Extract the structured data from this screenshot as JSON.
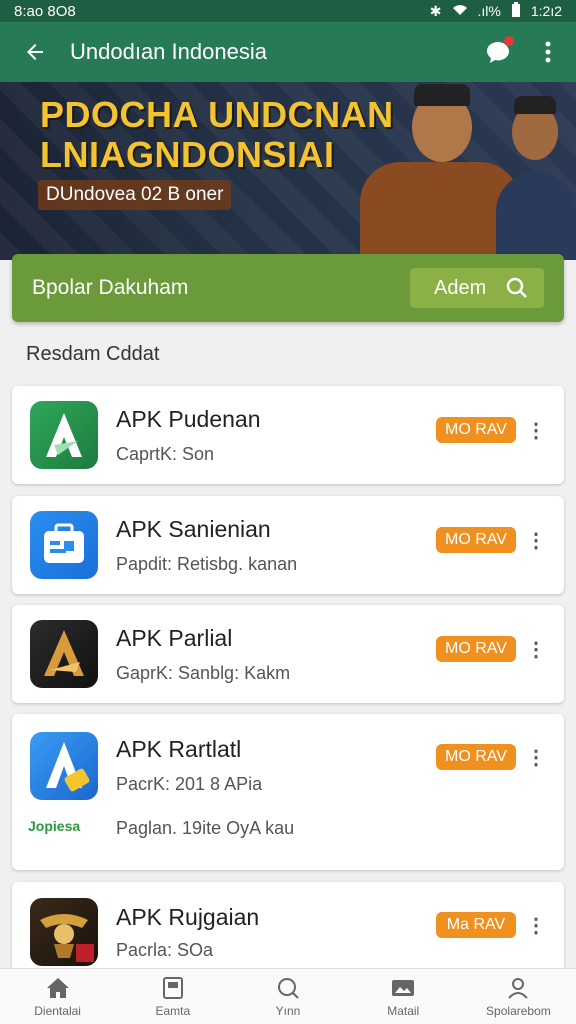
{
  "status_bar": {
    "time": "8:ao 8O8",
    "right_time": "1:2ı2",
    "signal": ".ıl%"
  },
  "app_bar": {
    "title": "Undodıan Indonesia"
  },
  "banner": {
    "title_line1": "PDOCHA UNDCNAN",
    "title_line2": "LNIAGNDONSIAI",
    "subtitle": "DUndovea 02 B oner"
  },
  "search": {
    "label": "Bpolar Dakuham",
    "button_label": "Adem"
  },
  "section_title": "Resdam Cddat",
  "apps": [
    {
      "name": "APK Pudenan",
      "meta": "CaprtK:  Son",
      "badge": "MO RAV",
      "icon_colors": [
        "#2fa85a",
        "#1d7a3f"
      ]
    },
    {
      "name": "APK Sanienian",
      "meta": "Papdit:  Retisbg. kanan",
      "badge": "MO RAV",
      "icon_colors": [
        "#2a8ef0",
        "#1a6fd8"
      ]
    },
    {
      "name": "APK Parlial",
      "meta": "GaprK:  Sanblg: Kakm",
      "badge": "MO RAV",
      "icon_colors": [
        "#2c2c2c",
        "#111111"
      ]
    },
    {
      "name": "APK Rartlatl",
      "meta": "PacrK:  201 8 APia",
      "meta2": "Paglan. 19ite OyA kau",
      "extra_logo": "Jopiesa",
      "badge": "MO RAV",
      "icon_colors": [
        "#3a9cf2",
        "#1b67d0"
      ]
    },
    {
      "name": "APK Rujgaian",
      "meta": "Pacrla:  SOa",
      "badge": "Ma RAV",
      "icon_colors": [
        "#3a2a1a",
        "#1a120a"
      ]
    }
  ],
  "bottom_nav": [
    {
      "label": "Dientalai",
      "icon": "home-icon"
    },
    {
      "label": "Eamta",
      "icon": "tablet-icon"
    },
    {
      "label": "Yınn",
      "icon": "search-icon"
    },
    {
      "label": "Matail",
      "icon": "image-icon"
    },
    {
      "label": "Spolarebom",
      "icon": "profile-icon"
    }
  ]
}
